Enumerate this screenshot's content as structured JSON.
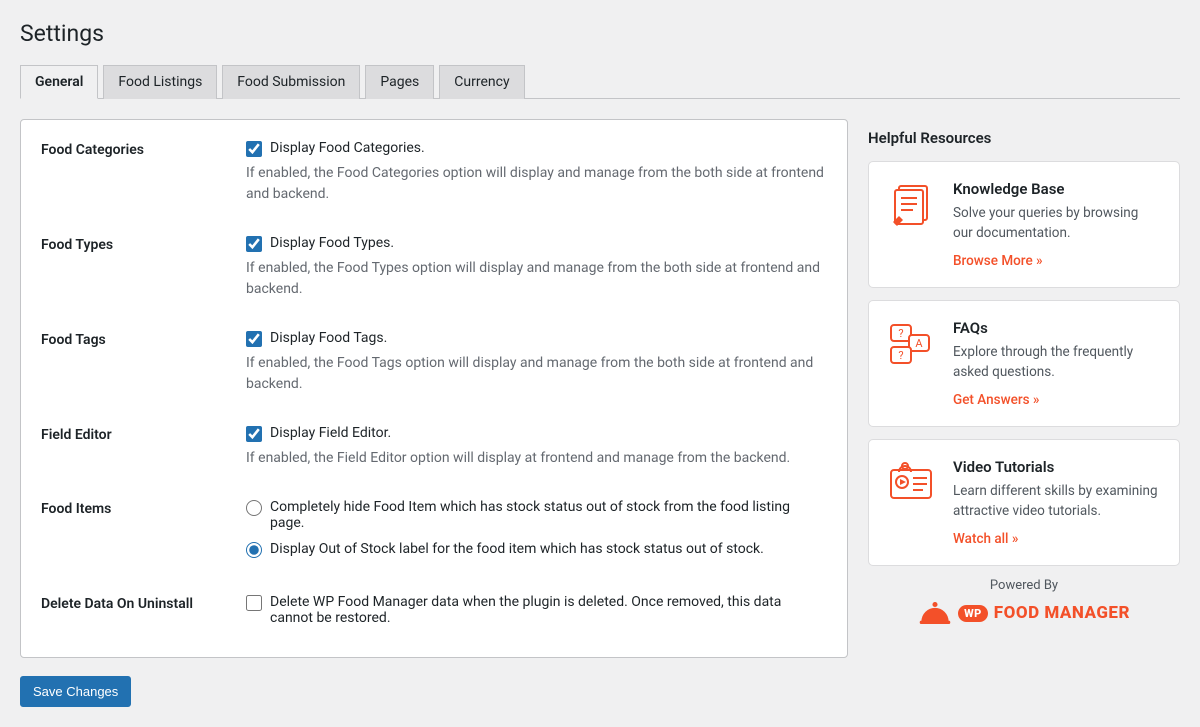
{
  "page_title": "Settings",
  "tabs": [
    {
      "label": "General",
      "active": true
    },
    {
      "label": "Food Listings",
      "active": false
    },
    {
      "label": "Food Submission",
      "active": false
    },
    {
      "label": "Pages",
      "active": false
    },
    {
      "label": "Currency",
      "active": false
    }
  ],
  "settings": {
    "food_categories": {
      "label": "Food Categories",
      "checkbox_label": "Display Food Categories.",
      "checked": true,
      "desc": "If enabled, the Food Categories option will display and manage from the both side at frontend and backend."
    },
    "food_types": {
      "label": "Food Types",
      "checkbox_label": "Display Food Types.",
      "checked": true,
      "desc": "If enabled, the Food Types option will display and manage from the both side at frontend and backend."
    },
    "food_tags": {
      "label": "Food Tags",
      "checkbox_label": "Display Food Tags.",
      "checked": true,
      "desc": "If enabled, the Food Tags option will display and manage from the both side at frontend and backend."
    },
    "field_editor": {
      "label": "Field Editor",
      "checkbox_label": "Display Field Editor.",
      "checked": true,
      "desc": "If enabled, the Field Editor option will display at frontend and manage from the backend."
    },
    "food_items": {
      "label": "Food Items",
      "options": [
        {
          "label": "Completely hide Food Item which has stock status out of stock from the food listing page.",
          "selected": false
        },
        {
          "label": "Display Out of Stock label for the food item which has stock status out of stock.",
          "selected": true
        }
      ]
    },
    "delete_data": {
      "label": "Delete Data On Uninstall",
      "checkbox_label": "Delete WP Food Manager data when the plugin is deleted. Once removed, this data cannot be restored.",
      "checked": false
    }
  },
  "save_button": "Save Changes",
  "sidebar": {
    "heading": "Helpful Resources",
    "cards": [
      {
        "title": "Knowledge Base",
        "text": "Solve your queries by browsing our documentation.",
        "link": "Browse More »"
      },
      {
        "title": "FAQs",
        "text": "Explore through the frequently asked questions.",
        "link": "Get Answers »"
      },
      {
        "title": "Video Tutorials",
        "text": "Learn different skills by examining attractive video tutorials.",
        "link": "Watch all »"
      }
    ],
    "powered_by": "Powered By",
    "brand_prefix": "WP",
    "brand_name": "FOOD MANAGER"
  }
}
